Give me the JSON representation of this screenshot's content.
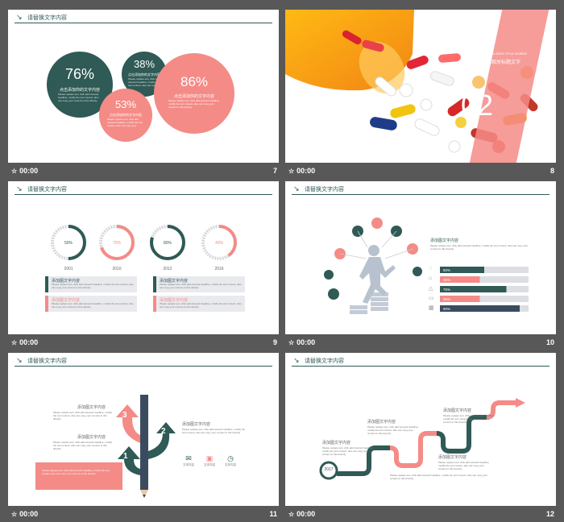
{
  "slides": [
    {
      "number": "7",
      "timer": "00:00",
      "header": "请替换文字内容",
      "circles": [
        {
          "pct": "76%",
          "label": "点击添加你的文字内容",
          "color": "#2f5a55"
        },
        {
          "pct": "38%",
          "label": "点击添加你的文字内容",
          "color": "#2f5a55"
        },
        {
          "pct": "53%",
          "label": "点击添加你的文字内容",
          "color": "#f48b87"
        },
        {
          "pct": "86%",
          "label": "点击添加你的文字内容",
          "color": "#f48b87"
        }
      ],
      "body": "Please replace text, click add relevant headline, modify the text content, also can copy your content to this directly."
    },
    {
      "number": "8",
      "timer": "00:00",
      "small_caption": "ADD RELATED TITLE WORDS",
      "title": "添加相关标题文字",
      "big": "02"
    },
    {
      "number": "9",
      "timer": "00:00",
      "header": "请替换文字内容",
      "rings": [
        {
          "pct": "50%",
          "year": "2001",
          "value": 0.5,
          "color": "#2f5a55"
        },
        {
          "pct": "70%",
          "year": "2010",
          "value": 0.7,
          "color": "#f48b87"
        },
        {
          "pct": "80%",
          "year": "2012",
          "value": 0.8,
          "color": "#2f5a55"
        },
        {
          "pct": "40%",
          "year": "2016",
          "value": 0.4,
          "color": "#f48b87"
        }
      ],
      "box_title": "添加图文字内容",
      "box_body": "Please replace text, click add relevant headline, modify the text content, also can copy your content to this directly."
    },
    {
      "number": "10",
      "timer": "00:00",
      "header": "请替换文字内容",
      "heading": "添加图文字内容",
      "body": "Please replace text, click add relevant headline, modify the text content, also can copy your content to this directly.",
      "bars": [
        {
          "label": "50%",
          "value": 0.5,
          "color": "#2f5a55"
        },
        {
          "label": "45%",
          "value": 0.45,
          "color": "#f48b87"
        },
        {
          "label": "75%",
          "value": 0.75,
          "color": "#2f5a55"
        },
        {
          "label": "45%",
          "value": 0.45,
          "color": "#f48b87"
        },
        {
          "label": "90%",
          "value": 0.9,
          "color": "#3b4b5f"
        }
      ]
    },
    {
      "number": "11",
      "timer": "00:00",
      "header": "请替换文字内容",
      "item_title": "添加图文字内容",
      "body": "Please replace text, click add relevant headline, modify the text content, also can copy your content to this directly.",
      "steps": [
        "3",
        "2",
        "1"
      ],
      "icons": [
        {
          "label": "文本内容",
          "icon": "mail-icon"
        },
        {
          "label": "文本内容",
          "icon": "tv-icon"
        },
        {
          "label": "文本内容",
          "icon": "clock-icon"
        }
      ]
    },
    {
      "number": "12",
      "timer": "00:00",
      "header": "请替换文字内容",
      "year": "2017",
      "item_title": "添加图文字内容",
      "body": "Please replace text, click add relevant headline, modify the text content, also can copy your content to this directly."
    }
  ]
}
